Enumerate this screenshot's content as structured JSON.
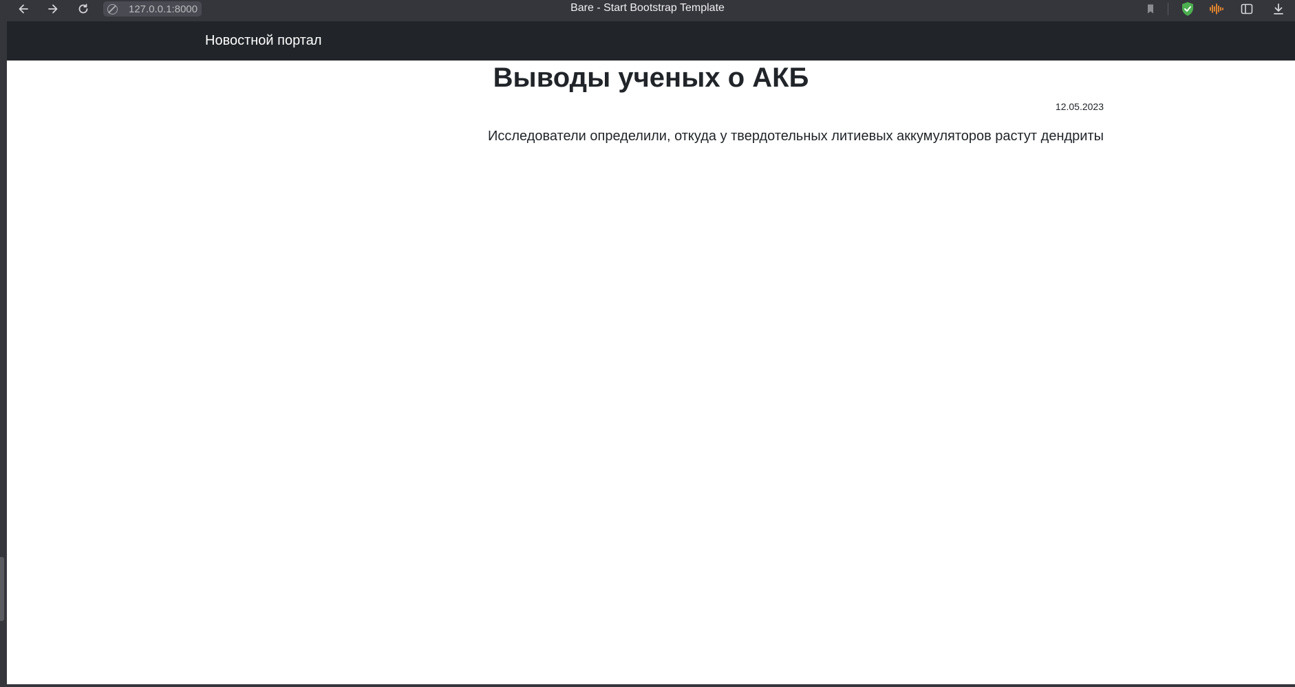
{
  "browser": {
    "url": "127.0.0.1:8000",
    "window_title": "Bare - Start Bootstrap Template",
    "icons": {
      "back": "arrow-left-icon",
      "forward": "arrow-right-icon",
      "reload": "reload-icon",
      "site": "site-info-icon",
      "bookmark": "bookmark-icon",
      "shield": "shield-check-icon",
      "audio": "audio-wave-icon",
      "sidebar": "sidebar-icon",
      "download": "download-icon"
    },
    "colors": {
      "chrome_bg": "#35363c",
      "shield": "#4caf50",
      "audio": "#f08c2e"
    }
  },
  "page": {
    "navbar": {
      "brand": "Новостной портал",
      "bg_color": "#212529"
    },
    "post": {
      "title": "Выводы ученых о АКБ",
      "date": "12.05.2023",
      "text": "Исследователи определили, откуда у твердотельных литиевых аккумуляторов растут дендриты"
    }
  }
}
